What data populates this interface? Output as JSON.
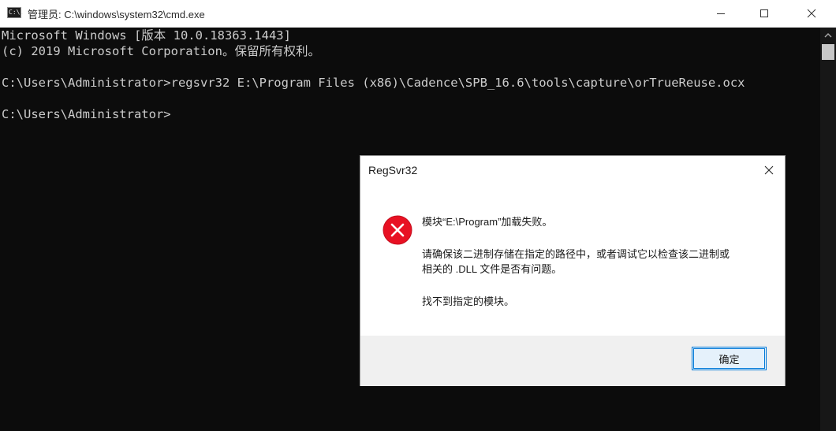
{
  "window": {
    "icon_text": "C:\\.",
    "title": "管理员: C:\\windows\\system32\\cmd.exe",
    "controls": [
      "minimize-icon",
      "maximize-icon",
      "close-icon"
    ]
  },
  "console": {
    "lines": [
      "Microsoft Windows [版本 10.0.18363.1443]",
      "(c) 2019 Microsoft Corporation。保留所有权利。",
      "",
      "C:\\Users\\Administrator>regsvr32 E:\\Program Files (x86)\\Cadence\\SPB_16.6\\tools\\capture\\orTrueReuse.ocx",
      "",
      "C:\\Users\\Administrator>"
    ]
  },
  "dialog": {
    "title": "RegSvr32",
    "icon": "error-icon",
    "message_line1": "模块“E:\\Program”加载失败。",
    "message_line2": "请确保该二进制存储在指定的路径中，或者调试它以检查该二进制或",
    "message_line3": "相关的 .DLL 文件是否有问题。",
    "message_line4": "找不到指定的模块。",
    "ok_label": "确定"
  },
  "colors": {
    "console_bg": "#0c0c0c",
    "console_text": "#cccccc",
    "error_red": "#e81123",
    "accent": "#0078d7"
  }
}
